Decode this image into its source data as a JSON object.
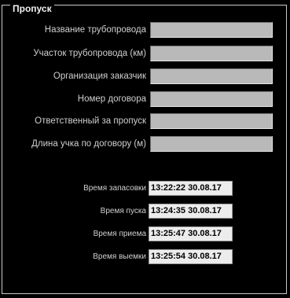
{
  "group": {
    "title": "Пропуск"
  },
  "fields": [
    {
      "label": "Название трубопровода",
      "value": ""
    },
    {
      "label": "Участок трубопровода (км)",
      "value": ""
    },
    {
      "label": "Организация заказчик",
      "value": ""
    },
    {
      "label": "Номер договора",
      "value": ""
    },
    {
      "label": "Ответственный за пропуск",
      "value": ""
    },
    {
      "label": "Длина учка по договору (м)",
      "value": ""
    }
  ],
  "times": [
    {
      "label": "Время запасовки",
      "value": "13:22:22 30.08.17"
    },
    {
      "label": "Время пуска",
      "value": "13:24:35 30.08.17"
    },
    {
      "label": "Время приема",
      "value": "13:25:47 30.08.17"
    },
    {
      "label": "Время выемки",
      "value": "13:25:54 30.08.17"
    }
  ]
}
